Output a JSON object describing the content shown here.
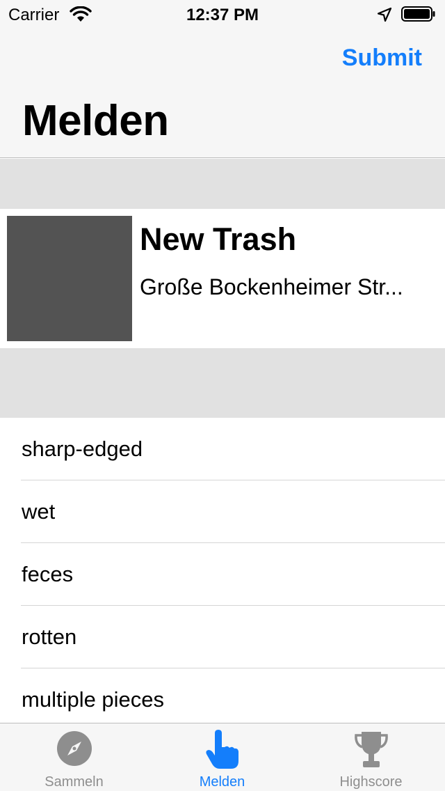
{
  "status_bar": {
    "carrier": "Carrier",
    "time": "12:37 PM",
    "icons": [
      "wifi-icon",
      "location-arrow-icon",
      "battery-icon"
    ]
  },
  "nav": {
    "submit_label": "Submit",
    "title": "Melden"
  },
  "trash": {
    "title": "New Trash",
    "address": "Große Bockenheimer Str..."
  },
  "attributes": [
    {
      "label": "sharp-edged"
    },
    {
      "label": "wet"
    },
    {
      "label": "feces"
    },
    {
      "label": "rotten"
    },
    {
      "label": "multiple pieces"
    }
  ],
  "tabs": [
    {
      "label": "Sammeln",
      "icon": "compass-icon",
      "active": false
    },
    {
      "label": "Melden",
      "icon": "pointing-hand-icon",
      "active": true
    },
    {
      "label": "Highscore",
      "icon": "trophy-icon",
      "active": false
    }
  ],
  "colors": {
    "accent": "#147efb",
    "inactive": "#8e8e8e",
    "separator": "#e1e1e1",
    "thumbnail": "#535353"
  }
}
